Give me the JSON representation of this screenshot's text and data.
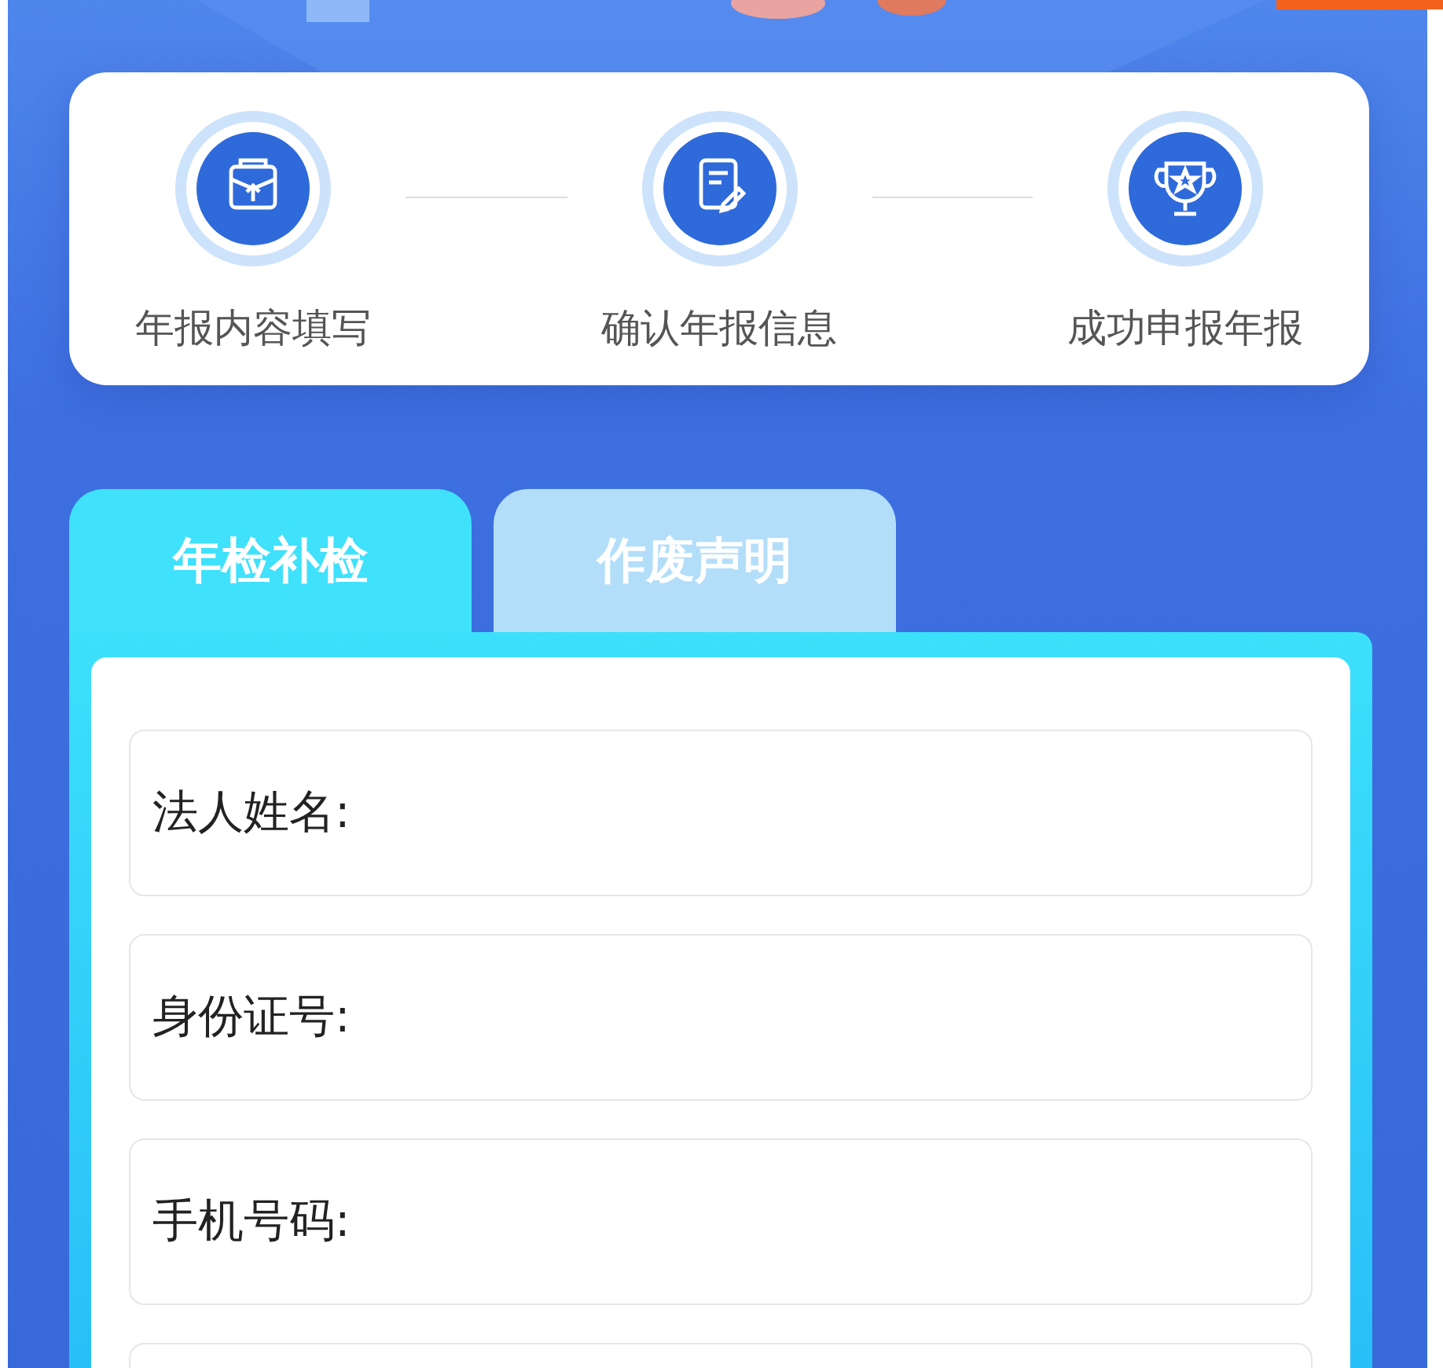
{
  "steps": [
    {
      "label": "年报内容填写",
      "kind": "upload"
    },
    {
      "label": "确认年报信息",
      "kind": "edit"
    },
    {
      "label": "成功申报年报",
      "kind": "trophy"
    }
  ],
  "tabs": [
    {
      "label": "年检补检",
      "selected": true
    },
    {
      "label": "作废声明",
      "selected": false
    }
  ],
  "fields": [
    {
      "label": "法人姓名:",
      "kind": "text"
    },
    {
      "label": "身份证号:",
      "kind": "text"
    },
    {
      "label": "手机号码:",
      "kind": "text"
    },
    {
      "kind": "text"
    }
  ]
}
